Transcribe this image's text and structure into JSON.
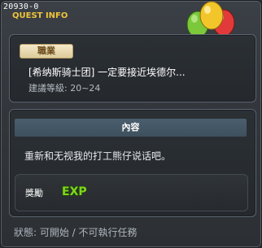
{
  "window": {
    "quest_id": "20930-0",
    "title": "QUEST INFO"
  },
  "job": {
    "tab_label": "職業",
    "quest_name": "[希纳斯骑士团] 一定要接近埃德尔...",
    "level_text": "建議等級: 20~24"
  },
  "content": {
    "header": "內容",
    "description": "重新和无视我的打工熊仔说话吧。"
  },
  "reward": {
    "label": "獎勵",
    "exp_text": "EXP"
  },
  "status": {
    "text": "狀態: 可開始 / 不可執行任務"
  },
  "colors": {
    "title": "#f0c33a",
    "accent_header": "#4a5e6e",
    "exp_green": "#7fd61c"
  },
  "icons": {
    "npc": "bear-with-balloons-icon",
    "reward": "exp-icon"
  }
}
